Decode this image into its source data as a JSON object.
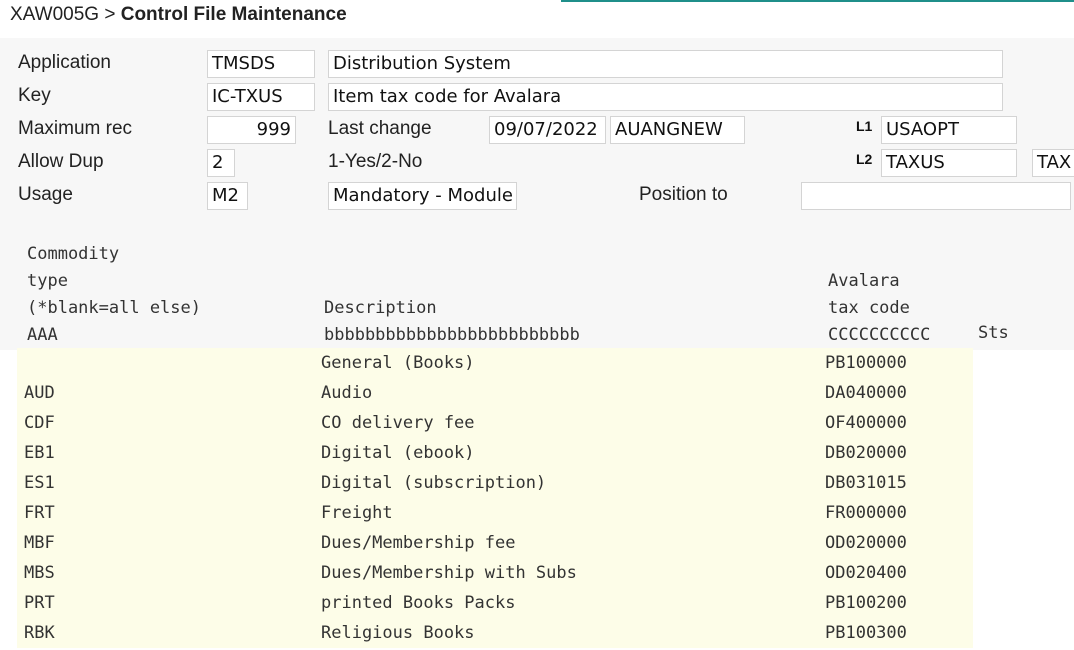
{
  "breadcrumb": {
    "program": "XAW005G",
    "separator": ">",
    "title": "Control File Maintenance"
  },
  "form": {
    "application_label": "Application",
    "application_code": "TMSDS",
    "application_desc": "Distribution System",
    "key_label": "Key",
    "key_value": "IC-TXUS",
    "key_desc": "Item tax code for Avalara",
    "max_rec_label": "Maximum rec",
    "max_rec_value": "999",
    "last_change_label": "Last change",
    "last_change_date": "09/07/2022",
    "last_change_user": "AUANGNEW",
    "l1_label": "L1",
    "l1_value": "USAOPT",
    "allow_dup_label": "Allow Dup",
    "allow_dup_value": "2",
    "allow_dup_hint": "1-Yes/2-No",
    "l2_label": "L2",
    "l2_value": "TAXUS",
    "l2_extra": "TAX",
    "usage_label": "Usage",
    "usage_value": "M2",
    "usage_desc": "Mandatory - Module",
    "position_label": "Position to",
    "position_value": ""
  },
  "table": {
    "headers": {
      "col1_line1": "Commodity",
      "col1_line2": "type",
      "col1_line3": "(*blank=all else)",
      "col1_line4": "AAA",
      "col2_line3": "Description",
      "col2_line4": "bbbbbbbbbbbbbbbbbbbbbbbbb",
      "col3_line2": "Avalara",
      "col3_line3": "tax code",
      "col3_line4": "CCCCCCCCCC",
      "col4_line4": "Sts"
    },
    "rows": [
      {
        "type": "",
        "description": "General (Books)",
        "tax_code": "PB100000"
      },
      {
        "type": "AUD",
        "description": "Audio",
        "tax_code": "DA040000"
      },
      {
        "type": "CDF",
        "description": "CO delivery fee",
        "tax_code": "OF400000"
      },
      {
        "type": "EB1",
        "description": "Digital (ebook)",
        "tax_code": "DB020000"
      },
      {
        "type": "ES1",
        "description": "Digital (subscription)",
        "tax_code": "DB031015"
      },
      {
        "type": "FRT",
        "description": "Freight",
        "tax_code": "FR000000"
      },
      {
        "type": "MBF",
        "description": "Dues/Membership fee",
        "tax_code": "OD020000"
      },
      {
        "type": "MBS",
        "description": "Dues/Membership with Subs",
        "tax_code": "OD020400"
      },
      {
        "type": "PRT",
        "description": "printed Books Packs",
        "tax_code": "PB100200"
      },
      {
        "type": "RBK",
        "description": "Religious Books",
        "tax_code": "PB100300"
      }
    ]
  },
  "colors": {
    "accent": "#1f8f8a",
    "row_bg": "#fdfde8",
    "panel_bg": "#f7f7f7"
  }
}
